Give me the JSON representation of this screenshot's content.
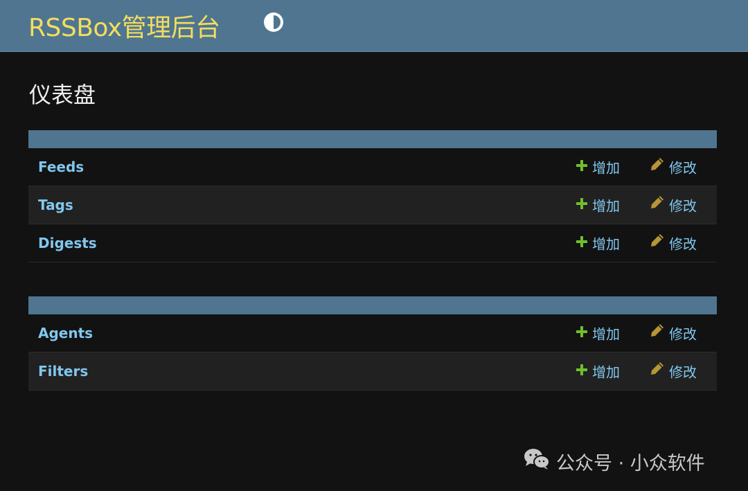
{
  "header": {
    "site_title": "RSSBox管理后台",
    "theme_toggle_icon": "half-circle-contrast-icon"
  },
  "main": {
    "page_title": "仪表盘",
    "modules": [
      {
        "caption": "",
        "models": [
          {
            "name": "Feeds",
            "add_label": "增加",
            "change_label": "修改"
          },
          {
            "name": "Tags",
            "add_label": "增加",
            "change_label": "修改"
          },
          {
            "name": "Digests",
            "add_label": "增加",
            "change_label": "修改"
          }
        ]
      },
      {
        "caption": "",
        "models": [
          {
            "name": "Agents",
            "add_label": "增加",
            "change_label": "修改"
          },
          {
            "name": "Filters",
            "add_label": "增加",
            "change_label": "修改"
          }
        ]
      }
    ]
  },
  "watermark": {
    "text": "公众号 · 小众软件",
    "icon": "wechat-icon"
  },
  "colors": {
    "header_bg": "#4f7591",
    "site_title": "#f5dd5d",
    "link": "#81c7ee",
    "add_icon": "#70bf2b",
    "change_icon": "#b79536",
    "page_bg": "#121212"
  }
}
